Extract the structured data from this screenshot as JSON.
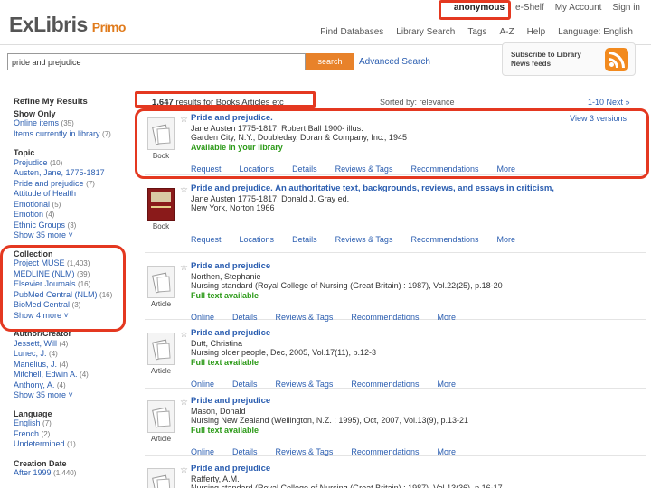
{
  "header": {
    "logo_main": "ExLibris",
    "logo_sub": "Primo",
    "top_links": [
      "anonymous",
      "e-Shelf",
      "My Account",
      "Sign in"
    ],
    "nav_links": [
      "Find Databases",
      "Library Search",
      "Tags",
      "A-Z",
      "Help",
      "Language: English"
    ]
  },
  "search": {
    "query": "pride and prejudice",
    "button_label": "search",
    "advanced_label": "Advanced Search",
    "subscribe_text": "Subscribe to Library News feeds",
    "rss_icon": "rss-icon"
  },
  "sidebar": {
    "title": "Refine My Results",
    "groups": [
      {
        "heading": "Show Only",
        "items": [
          {
            "label": "Online items",
            "count": "(35)"
          },
          {
            "label": "Items currently in library",
            "count": "(7)"
          }
        ],
        "more": ""
      },
      {
        "heading": "Topic",
        "items": [
          {
            "label": "Prejudice",
            "count": "(10)"
          },
          {
            "label": "Austen, Jane, 1775-1817",
            "count": ""
          },
          {
            "label": "Pride and prejudice",
            "count": "(7)"
          },
          {
            "label": "Attitude of Health",
            "count": ""
          },
          {
            "label": "Emotional",
            "count": "(5)"
          },
          {
            "label": "Emotion",
            "count": "(4)"
          },
          {
            "label": "Ethnic Groups",
            "count": "(3)"
          }
        ],
        "more": "Show 35 more"
      },
      {
        "heading": "Collection",
        "items": [
          {
            "label": "Project MUSE",
            "count": "(1,403)"
          },
          {
            "label": "MEDLINE (NLM)",
            "count": "(39)"
          },
          {
            "label": "Elsevier Journals",
            "count": "(16)"
          },
          {
            "label": "PubMed Central (NLM)",
            "count": "(16)"
          },
          {
            "label": "BioMed Central",
            "count": "(3)"
          }
        ],
        "more": "Show 4 more"
      },
      {
        "heading": "Author/Creator",
        "items": [
          {
            "label": "Jessett, Will",
            "count": "(4)"
          },
          {
            "label": "Lunec, J.",
            "count": "(4)"
          },
          {
            "label": "Manelius, J.",
            "count": "(4)"
          },
          {
            "label": "Mitchell, Edwin A.",
            "count": "(4)"
          },
          {
            "label": "Anthony, A.",
            "count": "(4)"
          }
        ],
        "more": "Show 35 more"
      },
      {
        "heading": "Language",
        "items": [
          {
            "label": "English",
            "count": "(7)"
          },
          {
            "label": "French",
            "count": "(2)"
          },
          {
            "label": "Undetermined",
            "count": "(1)"
          }
        ],
        "more": ""
      },
      {
        "heading": "Creation Date",
        "items": [
          {
            "label": "After 1999",
            "count": "(1,440)"
          }
        ],
        "more": ""
      }
    ]
  },
  "results": {
    "count_number": "1,647",
    "count_text": "results for Books Articles etc",
    "sort_label": "Sorted by: relevance",
    "pager": "1-10 Next »"
  },
  "records": [
    {
      "thumb_label": "Book",
      "thumb_type": "page",
      "title": "Pride and prejudice.",
      "lines": [
        "Jane Austen 1775-1817; Robert Ball 1900- illus.",
        "Garden City, N.Y., Doubleday, Doran & Company, Inc., 1945"
      ],
      "avail": "Available in your library",
      "versions": "View 3 versions",
      "tabs": [
        "Request",
        "Locations",
        "Details",
        "Reviews & Tags",
        "Recommendations",
        "More"
      ]
    },
    {
      "thumb_label": "Book",
      "thumb_type": "cover",
      "title": "Pride and prejudice. An authoritative text, backgrounds, reviews, and essays in criticism,",
      "lines": [
        "Jane Austen 1775-1817; Donald J. Gray ed.",
        "New York, Norton 1966"
      ],
      "avail": "",
      "versions": "",
      "tabs": [
        "Request",
        "Locations",
        "Details",
        "Reviews & Tags",
        "Recommendations",
        "More"
      ]
    },
    {
      "thumb_label": "Article",
      "thumb_type": "page",
      "title": "Pride and prejudice",
      "lines": [
        "Northen, Stephanie",
        "Nursing standard (Royal College of Nursing (Great Britain) : 1987), Vol.22(25), p.18-20"
      ],
      "avail": "Full text available",
      "versions": "",
      "tabs": [
        "Online",
        "Details",
        "Reviews & Tags",
        "Recommendations",
        "More"
      ]
    },
    {
      "thumb_label": "Article",
      "thumb_type": "page",
      "title": "Pride and prejudice",
      "lines": [
        "Dutt, Christina",
        "Nursing older people, Dec, 2005, Vol.17(11), p.12-3"
      ],
      "avail": "Full text available",
      "versions": "",
      "tabs": [
        "Online",
        "Details",
        "Reviews & Tags",
        "Recommendations",
        "More"
      ]
    },
    {
      "thumb_label": "Article",
      "thumb_type": "page",
      "title": "Pride and prejudice",
      "lines": [
        "Mason, Donald",
        "Nursing New Zealand (Wellington, N.Z. : 1995), Oct, 2007, Vol.13(9), p.13-21"
      ],
      "avail": "Full text available",
      "versions": "",
      "tabs": [
        "Online",
        "Details",
        "Reviews & Tags",
        "Recommendations",
        "More"
      ]
    },
    {
      "thumb_label": "Article",
      "thumb_type": "page",
      "title": "Pride and prejudice",
      "lines": [
        "Rafferty, A.M.",
        "Nursing standard (Royal College of Nursing (Great Britain) : 1987), Vol.13(36), p.16-17"
      ],
      "avail": "",
      "versions": "",
      "tabs": []
    }
  ],
  "colors": {
    "accent": "#e8822a",
    "link": "#2a5db0",
    "available": "#2c9a18",
    "annotation": "#e43820"
  }
}
